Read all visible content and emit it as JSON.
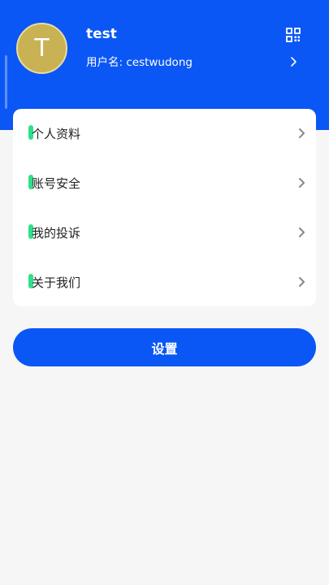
{
  "profile": {
    "avatar_letter": "T",
    "name": "test",
    "username_line": "用户名: cestwudong",
    "qr_icon": "qr-code-icon",
    "chevron_icon": "chevron-right-icon"
  },
  "menu": {
    "items": [
      {
        "label": "个人资料",
        "icon": "chevron-right-icon"
      },
      {
        "label": "账号安全",
        "icon": "chevron-right-icon"
      },
      {
        "label": "我的投诉",
        "icon": "chevron-right-icon"
      },
      {
        "label": "关于我们",
        "icon": "chevron-right-icon"
      }
    ]
  },
  "settings_button": {
    "label": "设置"
  },
  "colors": {
    "primary": "#0a57f5",
    "avatar_bg": "#c9b254",
    "marker": "#2fe08a",
    "background": "#f6f6f6"
  }
}
